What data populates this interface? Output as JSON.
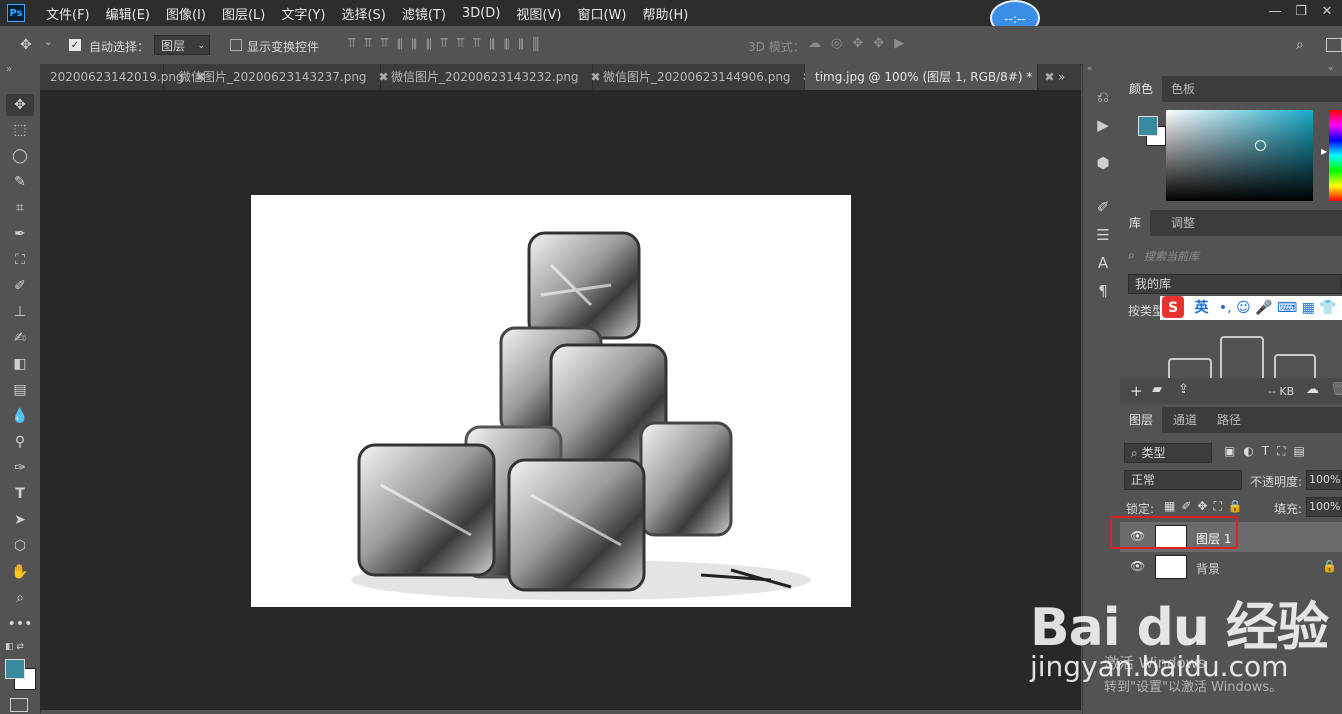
{
  "app": {
    "logo": "Ps"
  },
  "menu": [
    "文件(F)",
    "编辑(E)",
    "图像(I)",
    "图层(L)",
    "文字(Y)",
    "选择(S)",
    "滤镜(T)",
    "3D(D)",
    "视图(V)",
    "窗口(W)",
    "帮助(H)"
  ],
  "center_badge": "--:--",
  "options": {
    "auto_select_label": "自动选择：",
    "auto_select_checked": true,
    "layer_select_value": "图层",
    "show_transform_label": "显示变换控件",
    "mode_3d_label": "3D 模式："
  },
  "tabs": [
    {
      "label": "2020062314201​9.png",
      "active": false
    },
    {
      "label": "微信图片_20200623143237.png",
      "active": false
    },
    {
      "label": "微信图片_20200623143232.png",
      "active": false
    },
    {
      "label": "微信图片_20200623144906.png",
      "active": false
    },
    {
      "label": "timg.jpg @ 100% (图层 1, RGB/8#) *",
      "active": true
    }
  ],
  "panels": {
    "color_tabs": [
      "颜色",
      "色板"
    ],
    "library_tabs": [
      "库",
      "调整"
    ],
    "library_search_placeholder": "搜索当前库",
    "my_library": "我的库",
    "by_type": "按类型",
    "library_size": "-- KB",
    "layer_tabs": [
      "图层",
      "通道",
      "路径"
    ],
    "kind_filter": "类型",
    "blend_mode": "正常",
    "opacity_label": "不透明度:",
    "opacity_value": "100%",
    "lock_label": "锁定:",
    "fill_label": "填充:",
    "fill_value": "100%"
  },
  "layers": [
    {
      "name": "图层 1",
      "selected": true,
      "visible": true,
      "locked": false
    },
    {
      "name": "背景",
      "selected": false,
      "visible": true,
      "locked": true
    }
  ],
  "ime": {
    "brand": "S",
    "lang": "英"
  },
  "watermark": {
    "brand": "Bai du 经验",
    "url": "jingyan.baidu.com",
    "activate_line1": "激活 Windows",
    "activate_line2": "转到\"设置\"以激活 Windows。"
  },
  "colors": {
    "foreground": "#3a8a9e",
    "background": "#ffffff",
    "highlight": "#e02020"
  }
}
